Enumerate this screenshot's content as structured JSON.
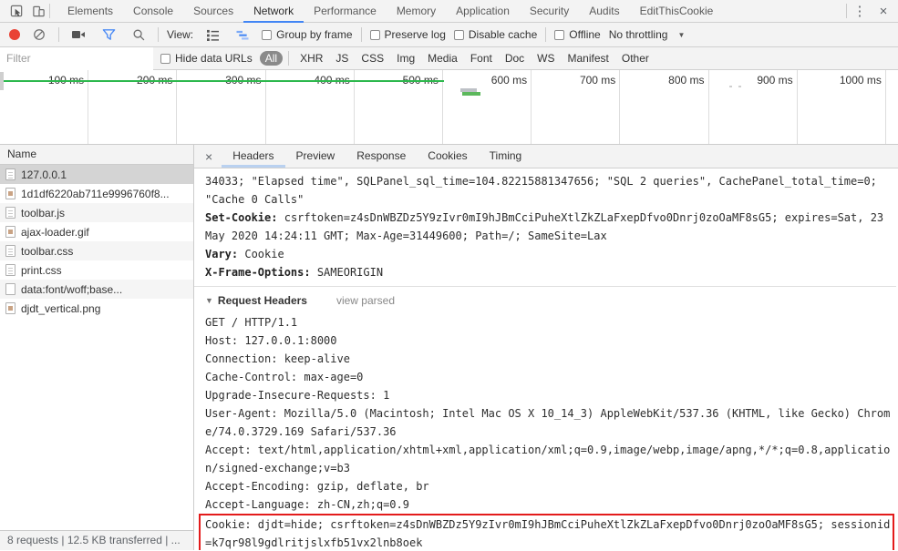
{
  "tab_bar": {
    "tabs": [
      "Elements",
      "Console",
      "Sources",
      "Network",
      "Performance",
      "Memory",
      "Application",
      "Security",
      "Audits",
      "EditThisCookie"
    ],
    "active_tab": "Network",
    "more_glyph": "⋮",
    "close_glyph": "×"
  },
  "toolbar": {
    "view_label": "View:",
    "group_by_frame": "Group by frame",
    "preserve_log": "Preserve log",
    "disable_cache": "Disable cache",
    "offline": "Offline",
    "throttling": "No throttling",
    "throttling_arrow": "▼"
  },
  "filter_bar": {
    "placeholder": "Filter",
    "hide_data_urls_label": "Hide data URLs",
    "selected_type": "All",
    "types": [
      "All",
      "XHR",
      "JS",
      "CSS",
      "Img",
      "Media",
      "Font",
      "Doc",
      "WS",
      "Manifest",
      "Other"
    ]
  },
  "timeline": {
    "ticks": [
      "100 ms",
      "200 ms",
      "300 ms",
      "400 ms",
      "500 ms",
      "600 ms",
      "700 ms",
      "800 ms",
      "900 ms",
      "1000 ms"
    ],
    "load_line_color": "#2db84d"
  },
  "requests_panel": {
    "name_header": "Name",
    "rows": [
      {
        "label": "127.0.0.1",
        "icon": "document-icon",
        "selected": true
      },
      {
        "label": "1d1df6220ab711e9996760f8...",
        "icon": "image-icon",
        "selected": false
      },
      {
        "label": "toolbar.js",
        "icon": "document-icon",
        "selected": false
      },
      {
        "label": "ajax-loader.gif",
        "icon": "image-icon",
        "selected": false
      },
      {
        "label": "toolbar.css",
        "icon": "document-icon",
        "selected": false
      },
      {
        "label": "print.css",
        "icon": "document-icon",
        "selected": false
      },
      {
        "label": "data:font/woff;base...",
        "icon": "file-icon",
        "selected": false
      },
      {
        "label": "djdt_vertical.png",
        "icon": "image-icon",
        "selected": false
      }
    ],
    "status_text": "8 requests | 12.5 KB transferred | ..."
  },
  "details_panel": {
    "close_glyph": "×",
    "tabs": [
      "Headers",
      "Preview",
      "Response",
      "Cookies",
      "Timing"
    ],
    "active_tab": "Headers",
    "response_overflow_line": "34033; \"Elapsed time\", SQLPanel_sql_time=104.82215881347656; \"SQL 2 queries\", CachePanel_total_time=0; \"Cache 0 Calls\"",
    "response_headers": [
      {
        "name": "Set-Cookie:",
        "value": "csrftoken=z4sDnWBZDz5Y9zIvr0mI9hJBmCciPuheXtlZkZLaFxepDfvo0Dnrj0zoOaMF8sG5; expires=Sat, 23 May 2020 14:24:11 GMT; Max-Age=31449600; Path=/; SameSite=Lax"
      },
      {
        "name": "Vary:",
        "value": "Cookie"
      },
      {
        "name": "X-Frame-Options:",
        "value": "SAMEORIGIN"
      }
    ],
    "request_headers_section": {
      "triangle": "▼",
      "label": "Request Headers",
      "toggle": "view parsed"
    },
    "request_headers_raw": [
      "GET / HTTP/1.1",
      "Host: 127.0.0.1:8000",
      "Connection: keep-alive",
      "Cache-Control: max-age=0",
      "Upgrade-Insecure-Requests: 1",
      "User-Agent: Mozilla/5.0 (Macintosh; Intel Mac OS X 10_14_3) AppleWebKit/537.36 (KHTML, like Gecko) Chrome/74.0.3729.169 Safari/537.36",
      "Accept: text/html,application/xhtml+xml,application/xml;q=0.9,image/webp,image/apng,*/*;q=0.8,application/signed-exchange;v=b3",
      "Accept-Encoding: gzip, deflate, br",
      "Accept-Language: zh-CN,zh;q=0.9"
    ],
    "highlighted_header": "Cookie: djdt=hide; csrftoken=z4sDnWBZDz5Y9zIvr0mI9hJBmCciPuheXtlZkZLaFxepDfvo0Dnrj0zoOaMF8sG5; sessionid=k7qr98l9gdlritjslxfb51vx2lnb8oek",
    "highlight_color": "#e31b1b"
  }
}
